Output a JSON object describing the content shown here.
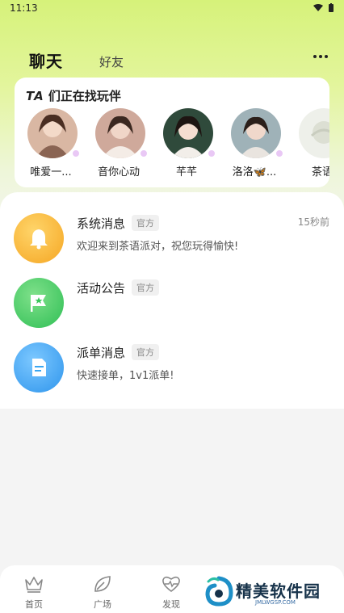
{
  "status_bar": {
    "time": "11:13"
  },
  "header": {
    "tab_chat": "聊天",
    "tab_friends": "好友"
  },
  "finding": {
    "title_prefix": "TA",
    "title_rest": " 们正在找玩伴",
    "avatars": [
      {
        "name": "唯爱一..."
      },
      {
        "name": "音你心动"
      },
      {
        "name": "芊芊"
      },
      {
        "name": "洛洛🦋..."
      },
      {
        "name": "茶语"
      }
    ]
  },
  "messages": [
    {
      "title": "系统消息",
      "badge": "官方",
      "subtitle": "欢迎来到茶语派对，祝您玩得愉快!",
      "time": "15秒前",
      "icon": "bell-icon",
      "color": "#f7b62a"
    },
    {
      "title": "活动公告",
      "badge": "官方",
      "subtitle": "",
      "time": "",
      "icon": "flag-star-icon",
      "color": "#39c75b"
    },
    {
      "title": "派单消息",
      "badge": "官方",
      "subtitle": "快速接单，1v1派单!",
      "time": "",
      "icon": "document-icon",
      "color": "#3aa7f2"
    }
  ],
  "bottom_nav": [
    {
      "label": "首页",
      "icon": "crown-icon"
    },
    {
      "label": "广场",
      "icon": "leaf-icon"
    },
    {
      "label": "发现",
      "icon": "heart-pulse-icon"
    }
  ],
  "watermark": {
    "text": "精美软件园",
    "sub": "JMLWGSP.COM"
  },
  "colors": {
    "accent": "#b9e93a",
    "header_gradient": "#d6f27a"
  }
}
